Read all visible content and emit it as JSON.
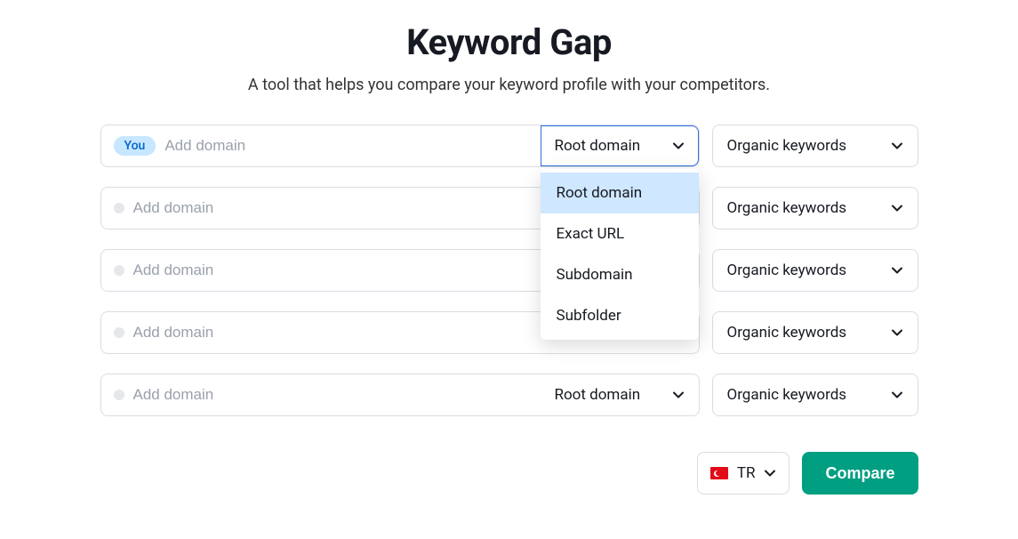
{
  "header": {
    "title": "Keyword Gap",
    "subtitle": "A tool that helps you compare your keyword profile with your competitors."
  },
  "badges": {
    "you": "You"
  },
  "placeholders": {
    "domain": "Add domain"
  },
  "scope": {
    "selected": "Root domain",
    "options": [
      "Root domain",
      "Exact URL",
      "Subdomain",
      "Subfolder"
    ]
  },
  "keywords": {
    "selected": "Organic keywords"
  },
  "rows": [
    {
      "isYou": true,
      "scope_open": true
    },
    {
      "isYou": false,
      "scope_open": false
    },
    {
      "isYou": false,
      "scope_open": false
    },
    {
      "isYou": false,
      "scope_open": false
    },
    {
      "isYou": false,
      "scope_open": false
    }
  ],
  "footer": {
    "country_code": "TR",
    "compare_label": "Compare"
  }
}
